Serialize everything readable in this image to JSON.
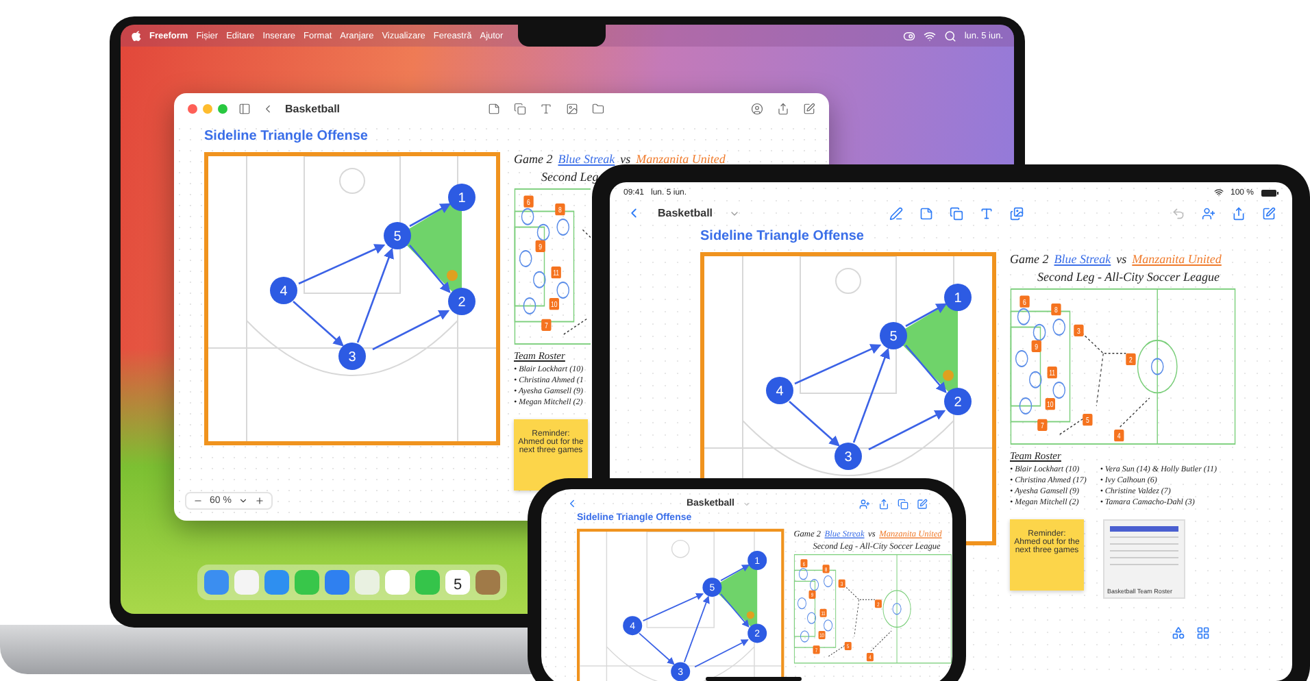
{
  "laptop": {
    "menu_bar": {
      "app": "Freeform",
      "menus": [
        "Fișier",
        "Editare",
        "Inserare",
        "Format",
        "Aranjare",
        "Vizualizare",
        "Fereastră",
        "Ajutor"
      ],
      "clock": "lun. 5 iun."
    },
    "window": {
      "title": "Basketball",
      "zoom": "60 %",
      "board": {
        "heading": "Sideline Triangle Offense",
        "players": [
          {
            "label": "1"
          },
          {
            "label": "2"
          },
          {
            "label": "3"
          },
          {
            "label": "4"
          },
          {
            "label": "5"
          }
        ],
        "game": {
          "label": "Game 2",
          "home": "Blue Streak",
          "vs": "vs",
          "away": "Manzanita United",
          "subtitle": "Second Leg"
        },
        "field_markers": [
          {
            "label": "6"
          },
          {
            "label": "8"
          },
          {
            "label": "9"
          },
          {
            "label": "11"
          },
          {
            "label": "10"
          },
          {
            "label": "7"
          }
        ],
        "roster": {
          "title": "Team Roster",
          "columns": [
            [
              "• Blair Lockhart (10)",
              "• Christina Ahmed (1",
              "• Ayesha Gamsell (9)",
              "• Megan Mitchell (2)"
            ]
          ]
        },
        "sticky_note": "Reminder: Ahmed out for the next three games"
      }
    },
    "dock": {
      "calendar_day": "5"
    }
  },
  "tablet": {
    "status_bar": {
      "time": "09:41",
      "date": "lun. 5 iun.",
      "battery": "100 %"
    },
    "title": "Basketball",
    "board": {
      "heading": "Sideline Triangle Offense",
      "players": [
        {
          "label": "1"
        },
        {
          "label": "2"
        },
        {
          "label": "3"
        },
        {
          "label": "4"
        },
        {
          "label": "5"
        }
      ],
      "game": {
        "label": "Game 2",
        "home": "Blue Streak",
        "vs": "vs",
        "away": "Manzanita United",
        "subtitle": "Second Leg - All-City Soccer League"
      },
      "field_markers": [
        {
          "label": "6"
        },
        {
          "label": "8"
        },
        {
          "label": "9"
        },
        {
          "label": "11"
        },
        {
          "label": "10"
        },
        {
          "label": "7"
        },
        {
          "label": "3"
        },
        {
          "label": "5"
        },
        {
          "label": "2"
        },
        {
          "label": "4"
        }
      ],
      "roster": {
        "title": "Team Roster",
        "columns": [
          [
            "• Blair Lockhart (10)",
            "• Christina Ahmed (17)",
            "• Ayesha Gamsell (9)",
            "• Megan Mitchell (2)"
          ],
          [
            "• Vera Sun (14) & Holly Butler (11)",
            "• Ivy Calhoun (6)",
            "• Christine Valdez (7)",
            "• Tamara Camacho-Dahl (3)"
          ]
        ]
      },
      "sticky_note": "Reminder: Ahmed out for the next three games",
      "attachment": {
        "title": "Basketball Team Roster"
      }
    }
  },
  "phone": {
    "title": "Basketball",
    "board": {
      "heading": "Sideline Triangle Offense",
      "players": [
        {
          "label": "1"
        },
        {
          "label": "2"
        },
        {
          "label": "3"
        },
        {
          "label": "4"
        },
        {
          "label": "5"
        }
      ],
      "game": {
        "label": "Game 2",
        "home": "Blue Streak",
        "vs": "vs",
        "away": "Manzanita United",
        "subtitle": "Second Leg - All-City Soccer League"
      },
      "field_markers": [
        {
          "label": "6"
        },
        {
          "label": "8"
        },
        {
          "label": "9"
        },
        {
          "label": "11"
        },
        {
          "label": "10"
        },
        {
          "label": "7"
        },
        {
          "label": "3"
        },
        {
          "label": "5"
        },
        {
          "label": "2"
        },
        {
          "label": "4"
        }
      ]
    }
  }
}
